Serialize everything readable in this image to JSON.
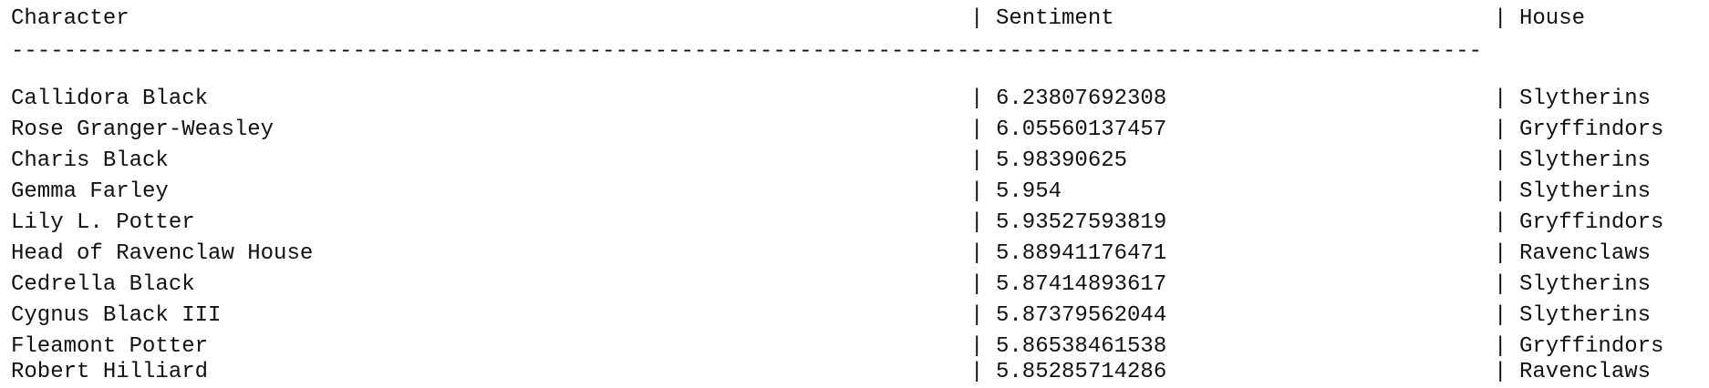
{
  "table": {
    "headers": {
      "character": "Character",
      "sentiment": "Sentiment",
      "house": "House"
    },
    "separator": "|",
    "rule": "----------------------------------------------------------------------------------------------------------------",
    "rows": [
      {
        "character": "Callidora Black",
        "sentiment": "6.23807692308",
        "house": "Slytherins"
      },
      {
        "character": "Rose Granger-Weasley",
        "sentiment": "6.05560137457",
        "house": "Gryffindors"
      },
      {
        "character": "Charis Black",
        "sentiment": "5.98390625",
        "house": "Slytherins"
      },
      {
        "character": "Gemma Farley",
        "sentiment": "5.954",
        "house": "Slytherins"
      },
      {
        "character": "Lily L. Potter",
        "sentiment": "5.93527593819",
        "house": "Gryffindors"
      },
      {
        "character": "Head of Ravenclaw House",
        "sentiment": "5.88941176471",
        "house": "Ravenclaws"
      },
      {
        "character": "Cedrella Black",
        "sentiment": "5.87414893617",
        "house": "Slytherins"
      },
      {
        "character": "Cygnus Black III",
        "sentiment": "5.87379562044",
        "house": "Slytherins"
      },
      {
        "character": "Fleamont Potter",
        "sentiment": "5.86538461538",
        "house": "Gryffindors"
      },
      {
        "character": "Robert Hilliard",
        "sentiment": "5.85285714286",
        "house": "Ravenclaws"
      }
    ]
  }
}
